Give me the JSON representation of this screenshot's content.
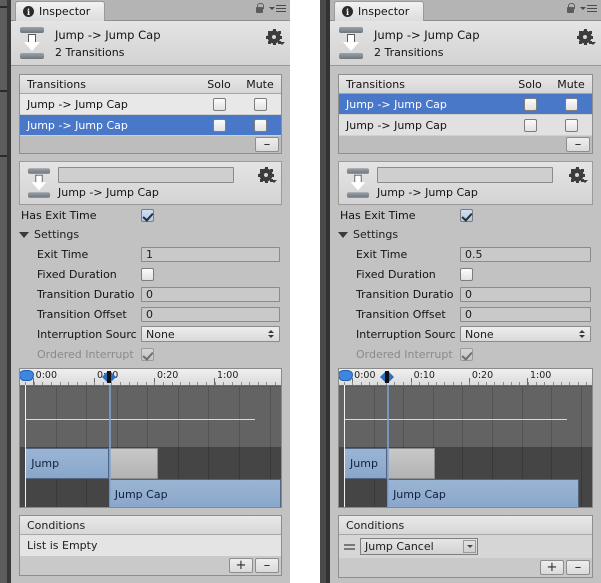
{
  "window": {
    "tab_label": "Inspector",
    "tab_icon": "info-icon",
    "lock_icon": "lock-icon",
    "menu_icon": "hamburger-menu-icon",
    "accent_selection": "#4a78c8",
    "panel_bg": "#c2c2c2"
  },
  "panels": [
    {
      "id": "left",
      "header": {
        "title": "Jump -> Jump Cap",
        "subtitle": "2 Transitions",
        "gear_icon": "gear-icon",
        "transition_icon": "transition-icon"
      },
      "transitions": {
        "header": "Transitions",
        "solo_header": "Solo",
        "mute_header": "Mute",
        "rows": [
          {
            "label": "Jump -> Jump Cap",
            "selected": false,
            "solo": false,
            "mute": false
          },
          {
            "label": "Jump -> Jump Cap",
            "selected": true,
            "solo": false,
            "mute": false
          }
        ],
        "remove_label": "–"
      },
      "preview": {
        "name_value": "",
        "caption": "Jump -> Jump Cap",
        "gear_icon": "gear-icon"
      },
      "has_exit_time": {
        "label": "Has Exit Time",
        "checked": true
      },
      "settings": {
        "label": "Settings",
        "expanded": true,
        "fields": [
          {
            "label": "Exit Time",
            "type": "text",
            "value": "1"
          },
          {
            "label": "Fixed Duration",
            "type": "checkbox",
            "checked": false
          },
          {
            "label": "Transition Duratio",
            "type": "text",
            "value": "0"
          },
          {
            "label": "Transition Offset",
            "type": "text",
            "value": "0"
          },
          {
            "label": "Interruption Sourc",
            "type": "dropdown",
            "value": "None"
          },
          {
            "label": "Ordered Interrupt",
            "type": "checkbox",
            "checked": true,
            "disabled": true
          }
        ]
      },
      "timeline": {
        "ticks": [
          "0:00",
          "0:10",
          "0:20",
          "1:00"
        ],
        "clips": [
          {
            "label": "Jump",
            "track": 0,
            "start_pct": 2,
            "width_pct": 32,
            "style": "blue"
          },
          {
            "label": "",
            "track": 0,
            "start_pct": 34,
            "width_pct": 19,
            "style": "gray"
          },
          {
            "label": "Jump Cap",
            "track": 1,
            "start_pct": 34,
            "width_pct": 66,
            "style": "blue"
          }
        ],
        "playhead_pct": 2,
        "marker_pct": 34
      },
      "conditions": {
        "header": "Conditions",
        "empty_text": "List is Empty",
        "rows": [],
        "add_label": "+",
        "remove_label": "–"
      }
    },
    {
      "id": "right",
      "header": {
        "title": "Jump -> Jump Cap",
        "subtitle": "2 Transitions",
        "gear_icon": "gear-icon",
        "transition_icon": "transition-icon"
      },
      "transitions": {
        "header": "Transitions",
        "solo_header": "Solo",
        "mute_header": "Mute",
        "rows": [
          {
            "label": "Jump -> Jump Cap",
            "selected": true,
            "solo": false,
            "mute": false
          },
          {
            "label": "Jump -> Jump Cap",
            "selected": false,
            "solo": false,
            "mute": false
          }
        ],
        "remove_label": "–"
      },
      "preview": {
        "name_value": "",
        "caption": "Jump -> Jump Cap",
        "gear_icon": "gear-icon"
      },
      "has_exit_time": {
        "label": "Has Exit Time",
        "checked": true
      },
      "settings": {
        "label": "Settings",
        "expanded": true,
        "fields": [
          {
            "label": "Exit Time",
            "type": "text",
            "value": "0.5"
          },
          {
            "label": "Fixed Duration",
            "type": "checkbox",
            "checked": false
          },
          {
            "label": "Transition Duratio",
            "type": "text",
            "value": "0"
          },
          {
            "label": "Transition Offset",
            "type": "text",
            "value": "0"
          },
          {
            "label": "Interruption Sourc",
            "type": "dropdown",
            "value": "None"
          },
          {
            "label": "Ordered Interrupt",
            "type": "checkbox",
            "checked": true,
            "disabled": true
          }
        ]
      },
      "timeline": {
        "ticks": [
          "0:00",
          "0:10",
          "0:20",
          "1:00"
        ],
        "clips": [
          {
            "label": "Jump",
            "track": 0,
            "start_pct": 2,
            "width_pct": 17,
            "style": "blue"
          },
          {
            "label": "",
            "track": 0,
            "start_pct": 19,
            "width_pct": 19,
            "style": "gray"
          },
          {
            "label": "Jump Cap",
            "track": 1,
            "start_pct": 19,
            "width_pct": 76,
            "style": "blue"
          }
        ],
        "playhead_pct": 2,
        "marker_pct": 19
      },
      "conditions": {
        "header": "Conditions",
        "empty_text": "",
        "rows": [
          {
            "parameter": "Jump Cancel",
            "handle_icon": "drag-handle-icon"
          }
        ],
        "add_label": "+",
        "remove_label": "–"
      }
    }
  ]
}
